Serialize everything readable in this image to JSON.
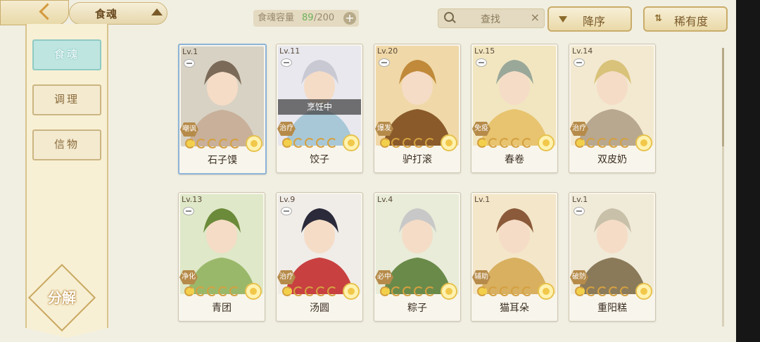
{
  "header": {
    "title": "食魂",
    "capacity_label": "食魂容量",
    "capacity_current": "89",
    "capacity_total": "/200",
    "plus": "+",
    "search_placeholder": "查找",
    "search_clear": "×",
    "sort_label": "降序",
    "rarity_label": "稀有度"
  },
  "sidebar": {
    "tabs": [
      {
        "label": "食魂",
        "active": true
      },
      {
        "label": "调理",
        "active": false
      },
      {
        "label": "信物",
        "active": false
      }
    ],
    "decompose_label": "分解"
  },
  "cards": [
    {
      "level": "Lv.1",
      "name": "石子馍",
      "role": "嘲讽",
      "status": ""
    },
    {
      "level": "Lv.11",
      "name": "饺子",
      "role": "治疗",
      "status": "烹饪中"
    },
    {
      "level": "Lv.20",
      "name": "驴打滚",
      "role": "爆发",
      "status": ""
    },
    {
      "level": "Lv.15",
      "name": "春卷",
      "role": "免疫",
      "status": ""
    },
    {
      "level": "Lv.14",
      "name": "双皮奶",
      "role": "治疗",
      "status": ""
    },
    {
      "level": "Lv.13",
      "name": "青团",
      "role": "净化",
      "status": ""
    },
    {
      "level": "Lv.9",
      "name": "汤圆",
      "role": "治疗",
      "status": ""
    },
    {
      "level": "Lv.4",
      "name": "粽子",
      "role": "必中",
      "status": ""
    },
    {
      "level": "Lv.1",
      "name": "猫耳朵",
      "role": "辅助",
      "status": ""
    },
    {
      "level": "Lv.1",
      "name": "重阳糕",
      "role": "破防",
      "status": ""
    }
  ],
  "colors": {
    "accent_tab": "#bfe5e0",
    "capacity_count": "#6fb05a",
    "rarity_gold": "#f2c84a"
  }
}
